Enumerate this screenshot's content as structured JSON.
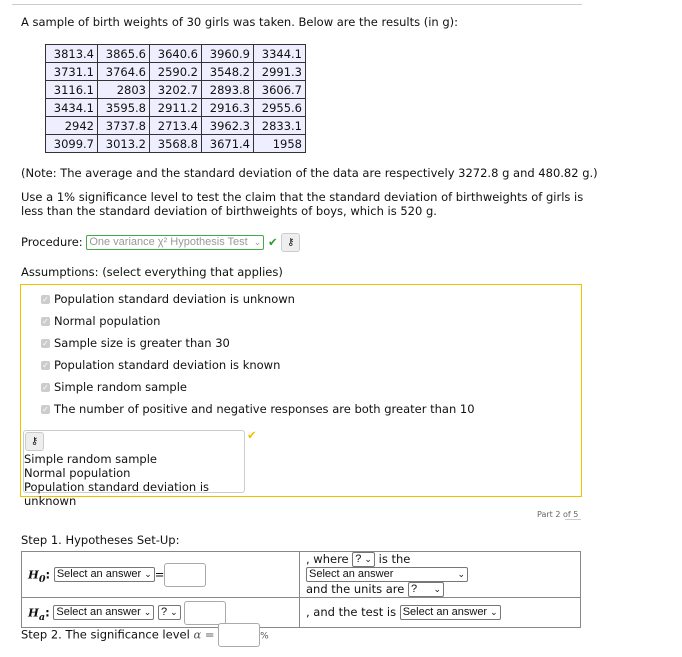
{
  "intro": "A sample of birth weights of 30 girls was taken. Below are the results (in g):",
  "table": [
    [
      "3813.4",
      "3865.6",
      "3640.6",
      "3960.9",
      "3344.1"
    ],
    [
      "3731.1",
      "3764.6",
      "2590.2",
      "3548.2",
      "2991.3"
    ],
    [
      "3116.1",
      "2803",
      "3202.7",
      "2893.8",
      "3606.7"
    ],
    [
      "3434.1",
      "3595.8",
      "2911.2",
      "2916.3",
      "2955.6"
    ],
    [
      "2942",
      "3737.8",
      "2713.4",
      "3962.3",
      "2833.1"
    ],
    [
      "3099.7",
      "3013.2",
      "3568.8",
      "3671.4",
      "1958"
    ]
  ],
  "note": "(Note: The average and the standard deviation of the data are respectively 3272.8 g and 480.82 g.)",
  "question": "Use a 1% significance level to test the claim that the standard deviation of birthweights of girls is less than the standard deviation of birthweights of boys, which is 520 g.",
  "procedure": {
    "label": "Procedure:",
    "value": "One variance χ² Hypothesis Test"
  },
  "assumptions": {
    "label": "Assumptions: (select everything that applies)",
    "options": [
      "Population standard deviation is unknown",
      "Normal population",
      "Sample size is greater than 30",
      "Population standard deviation is known",
      "Simple random sample",
      "The number of positive and negative responses are both greater than 10"
    ],
    "answers": [
      "Simple random sample",
      "Normal population",
      "Population standard deviation is unknown"
    ]
  },
  "part": "Part 2 of 5",
  "step1": "Step 1. Hypotheses Set-Up:",
  "h0": {
    "label": "H",
    "sub": "0",
    "select": "Select an answer",
    "eq": "="
  },
  "ha": {
    "label": "H",
    "sub": "a",
    "select": "Select an answer",
    "op": "?"
  },
  "where": {
    "t1": ", where",
    "sym": "?",
    "t2": "is the",
    "param": "Select an answer",
    "t3": "and the units are",
    "units": "?"
  },
  "test": {
    "t": ", and the test is",
    "select": "Select an answer"
  },
  "step2": {
    "label": "Step 2. The significance level",
    "alpha": "α =",
    "unit": "%"
  },
  "colors": {
    "correct": "#2a9d2a",
    "partial": "#f0c000"
  }
}
